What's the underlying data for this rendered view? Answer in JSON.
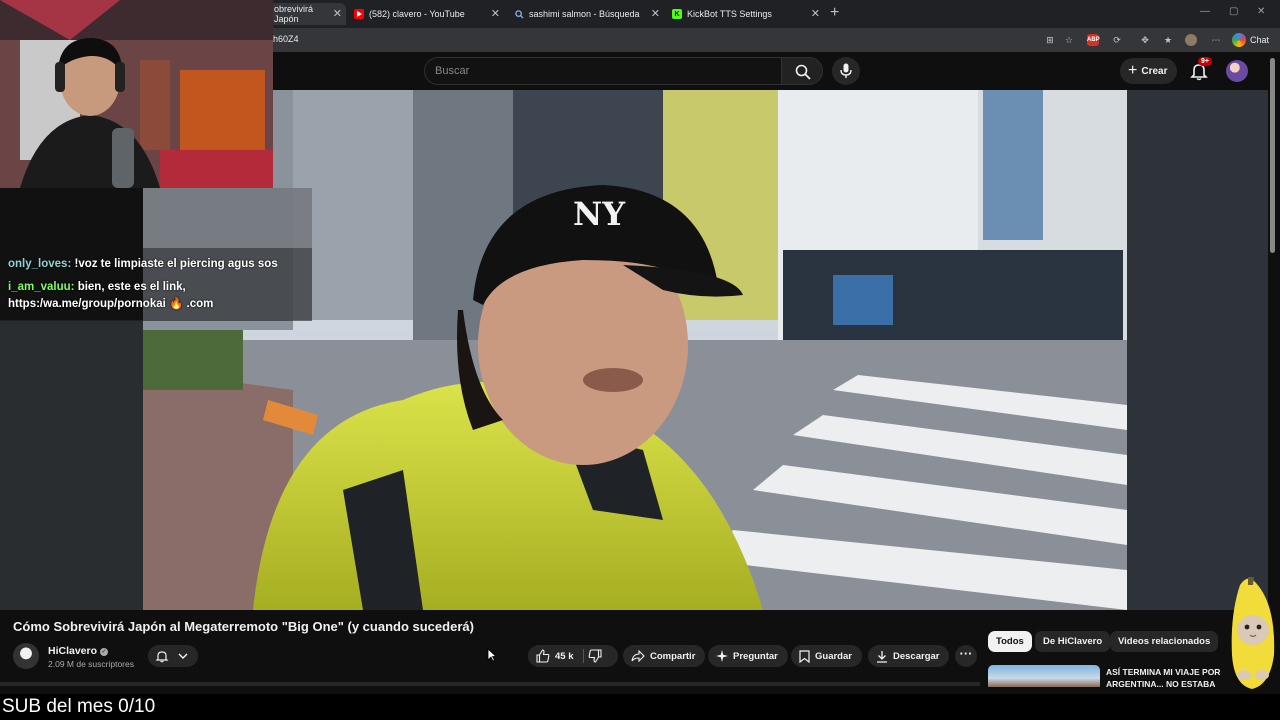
{
  "tabs": [
    {
      "label": "obrevivirá Japón",
      "close": "✕"
    },
    {
      "label": "(582) clavero - YouTube",
      "close": "✕"
    },
    {
      "label": "sashimi salmon - Búsqueda",
      "close": "✕"
    },
    {
      "label": "KickBot TTS Settings",
      "close": "✕"
    }
  ],
  "new_tab": "+",
  "url": "h60Z4",
  "browser_chat": "Chat",
  "search": {
    "placeholder": "Buscar"
  },
  "create_label": "Crear",
  "notif_count": "9+",
  "stream_chat": [
    {
      "user": "only_loves:",
      "message": "!voz te limpiaste el piercing agus sos"
    },
    {
      "user": "i_am_valuu:",
      "message": "bien, este es el link,"
    },
    {
      "user": "",
      "message": "https:/wa.me/group/pornokai 🔥 .com"
    }
  ],
  "video": {
    "title": "Cómo Sobrevivirá Japón al Megaterremoto \"Big One\" (y cuando sucederá)",
    "channel": "HiClavero",
    "subscribers": "2.09 M de suscriptores",
    "likes": "45 k"
  },
  "actions": {
    "share": "Compartir",
    "ask": "Preguntar",
    "save": "Guardar",
    "download": "Descargar",
    "more": "···"
  },
  "chips": [
    "Todos",
    "De HiClavero",
    "Videos relacionados"
  ],
  "recommended": {
    "title": "ASÍ TERMINA MI VIAJE POR ARGENTINA... NO ESTABA"
  },
  "stream_banner": "SUB del mes 0/10",
  "colors": {
    "bg": "#0f0f0f",
    "chip_active": "#f1f1f1",
    "jacket": "#c9d63a",
    "badge": "#cc0000"
  }
}
